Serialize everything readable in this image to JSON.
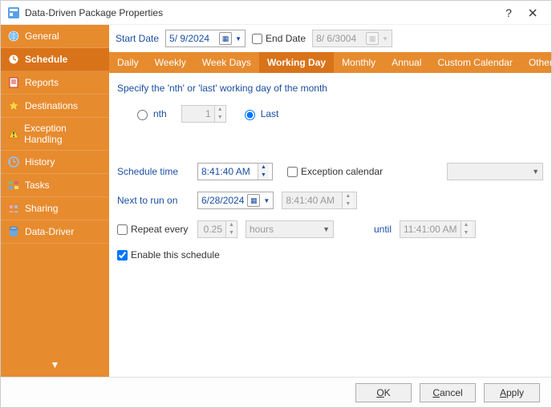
{
  "window": {
    "title": "Data-Driven Package Properties"
  },
  "sidebar": {
    "items": [
      {
        "label": "General"
      },
      {
        "label": "Schedule"
      },
      {
        "label": "Reports"
      },
      {
        "label": "Destinations"
      },
      {
        "label": "Exception Handling"
      },
      {
        "label": "History"
      },
      {
        "label": "Tasks"
      },
      {
        "label": "Sharing"
      },
      {
        "label": "Data-Driver"
      }
    ],
    "active_index": 1
  },
  "date_row": {
    "start_label": "Start Date",
    "start_value": "5/ 9/2024",
    "end_label": "End Date",
    "end_checked": false,
    "end_value": "8/ 6/3004"
  },
  "tabs": {
    "items": [
      "Daily",
      "Weekly",
      "Week Days",
      "Working Day",
      "Monthly",
      "Annual",
      "Custom Calendar",
      "Other"
    ],
    "active_index": 3
  },
  "working_day": {
    "hint": "Specify the 'nth' or 'last' working day of the month",
    "nth_label": "nth",
    "nth_value": "1",
    "nth_selected": false,
    "last_label": "Last",
    "last_selected": true
  },
  "schedule": {
    "time_label": "Schedule time",
    "time_value": "8:41:40 AM",
    "exception_label": "Exception calendar",
    "exception_checked": false,
    "exception_value": "",
    "next_label": "Next to run on",
    "next_date": "6/28/2024",
    "next_time": "8:41:40 AM",
    "repeat_label": "Repeat every",
    "repeat_checked": false,
    "repeat_value": "0.25",
    "repeat_unit": "hours",
    "until_label": "until",
    "until_value": "11:41:00 AM",
    "enable_label": "Enable this schedule",
    "enable_checked": true
  },
  "footer": {
    "ok": "OK",
    "cancel": "Cancel",
    "apply": "Apply"
  }
}
